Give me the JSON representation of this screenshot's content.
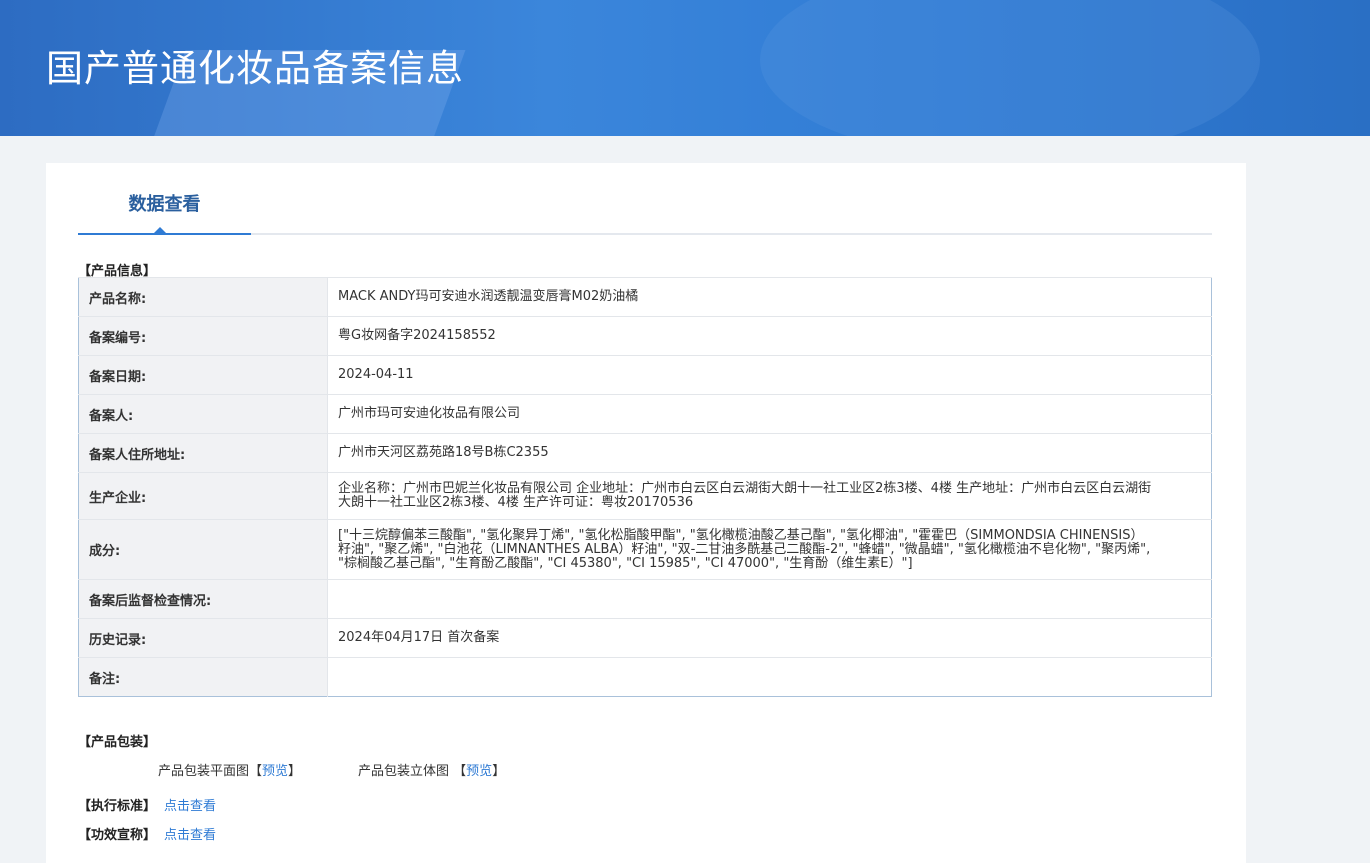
{
  "header": {
    "title": "国产普通化妆品备案信息"
  },
  "tabs": [
    {
      "label": "数据查看"
    }
  ],
  "product_info": {
    "section_title": "【产品信息】",
    "rows": [
      {
        "label": "产品名称:",
        "value": "MACK ANDY玛可安迪水润透靓温变唇膏M02奶油橘"
      },
      {
        "label": "备案编号:",
        "value": "粤G妆网备字2024158552"
      },
      {
        "label": "备案日期:",
        "value": "2024-04-11"
      },
      {
        "label": "备案人:",
        "value": "广州市玛可安迪化妆品有限公司"
      },
      {
        "label": "备案人住所地址:",
        "value": "广州市天河区荔苑路18号B栋C2355"
      },
      {
        "label": "生产企业:",
        "value": "企业名称：广州市巴妮兰化妆品有限公司 企业地址：广州市白云区白云湖街大朗十一社工业区2栋3楼、4楼 生产地址：广州市白云区白云湖街大朗十一社工业区2栋3楼、4楼 生产许可证：粤妆20170536"
      },
      {
        "label": "成分:",
        "value": "[\"十三烷醇偏苯三酸酯\", \"氢化聚异丁烯\", \"氢化松脂酸甲酯\", \"氢化橄榄油酸乙基己酯\", \"氢化椰油\", \"霍霍巴（SIMMONDSIA CHINENSIS）籽油\", \"聚乙烯\", \"白池花（LIMNANTHES ALBA）籽油\", \"双-二甘油多酰基己二酸酯-2\", \"蜂蜡\", \"微晶蜡\", \"氢化橄榄油不皂化物\", \"聚丙烯\", \"棕榈酸乙基己酯\", \"生育酚乙酸酯\", \"CI 45380\", \"CI 15985\", \"CI 47000\", \"生育酚（维生素E）\"]"
      },
      {
        "label": "备案后监督检查情况:",
        "value": ""
      },
      {
        "label": "历史记录:",
        "value": "2024年04月17日 首次备案"
      },
      {
        "label": "备注:",
        "value": ""
      }
    ]
  },
  "packaging": {
    "section_title": "【产品包装】",
    "flat_label": "产品包装平面图",
    "flat_open": "【",
    "flat_link": "预览",
    "flat_close": "】",
    "stereo_label": "产品包装立体图",
    "stereo_open": "【",
    "stereo_link": "预览",
    "stereo_close": "】"
  },
  "standard": {
    "section_title": "【执行标准】",
    "link": "点击查看"
  },
  "efficacy": {
    "section_title": "【功效宣称】",
    "link": "点击查看"
  },
  "colors": {
    "banner": "#2f7bd4",
    "tab_text": "#2a5f9e",
    "link": "#2f7bd4",
    "table_border": "#a9c1da",
    "label_bg": "#f1f2f4"
  }
}
